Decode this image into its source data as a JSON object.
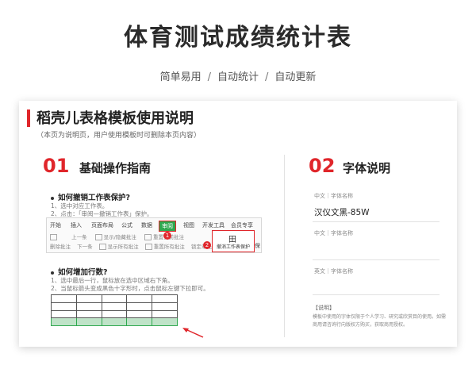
{
  "hero": {
    "title": "体育测试成绩统计表",
    "features": [
      "简单易用",
      "自动统计",
      "自动更新"
    ],
    "separator": "/"
  },
  "card": {
    "title": "稻壳儿表格模板使用说明",
    "note": "（本页为说明页，用户使用模板时可删除本页内容）"
  },
  "section1": {
    "number": "01",
    "title": "基础操作指南",
    "q1": {
      "title": "如何撤销工作表保护?",
      "steps": [
        "1、选中对应工作表。",
        "2、点击：「审阅—撤销工作表」保护。"
      ]
    },
    "ribbon": {
      "menus": [
        "开始",
        "插入",
        "页面布局",
        "公式",
        "数据",
        "审阅",
        "视图",
        "开发工具",
        "会员专享"
      ],
      "active_menu": "审阅",
      "row1": [
        "上一条",
        "显示/隐藏批注",
        "重置当前批注"
      ],
      "row2": [
        "删除批注",
        "下一条",
        "显示所有批注",
        "重置所有批注",
        "锁定单元格"
      ],
      "protect_label": "撤消工作表保护",
      "trailing": "保",
      "badge1": "1",
      "badge2": "2"
    },
    "q2": {
      "title": "如何增加行数?",
      "steps": [
        "1、选中最后一行，鼠标放在选中区域右下角。",
        "2、当鼠标箭头变成黑色十字形时，点击鼠标左键下拉即可。"
      ]
    }
  },
  "section2": {
    "number": "02",
    "title": "字体说明",
    "fields": [
      {
        "label": "中文｜字体名称",
        "value": "汉仪文黑-85W"
      },
      {
        "label": "中文｜字体名称",
        "value": ""
      },
      {
        "label": "英文｜字体名称",
        "value": ""
      }
    ],
    "note_title": "【说明】",
    "note_text": "模板中使用的字体仅限于个人学习、研究或欣赏目的使用。如需商用请咨询行向版权方购买，获取商用授权。"
  },
  "colors": {
    "accent": "#e0262b",
    "green": "#2fa84f"
  }
}
